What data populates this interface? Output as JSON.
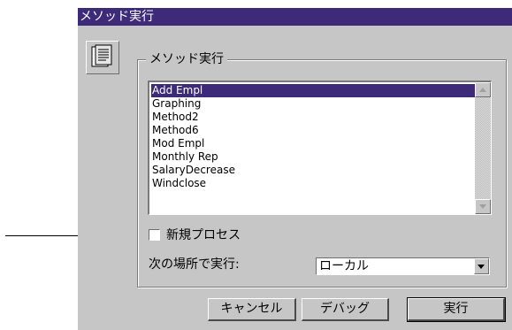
{
  "dialog": {
    "title": "メソッド実行",
    "group_label": "メソッド実行",
    "methods": [
      "Add Empl",
      "Graphing",
      "Method2",
      "Method6",
      "Mod Empl",
      "Monthly Rep",
      "SalaryDecrease",
      "Windclose"
    ],
    "selected_index": 0,
    "new_process_label": "新規プロセス",
    "new_process_checked": false,
    "location_label": "次の場所で実行:",
    "location_value": "ローカル",
    "buttons": {
      "cancel": "キャンセル",
      "debug": "デバッグ",
      "run": "実行"
    },
    "icon": "document-icon"
  },
  "colors": {
    "title_bar": "#3d2a78",
    "dialog_bg": "#c6c6c6",
    "selection": "#3d2a78"
  }
}
